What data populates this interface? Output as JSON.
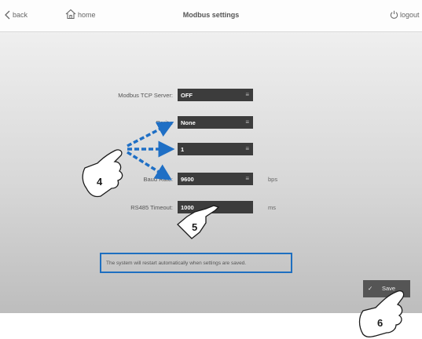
{
  "header": {
    "back_label": "back",
    "home_label": "home",
    "title": "Modbus settings",
    "logout_label": "logout"
  },
  "form": {
    "modbus_tcp_server": {
      "label": "Modbus TCP Server:",
      "value": "OFF"
    },
    "parity": {
      "label": "Parity:",
      "value": "None"
    },
    "stop_bits": {
      "value": "1"
    },
    "baud_rate": {
      "label": "Baud Rate:",
      "value": "9600",
      "unit": "bps"
    },
    "rs485_timeout": {
      "label": "RS485 Timeout:",
      "value": "1000",
      "unit": "ms"
    }
  },
  "notice": "The system will restart automatically when settings are saved.",
  "save_label": "Save",
  "callouts": [
    "4",
    "5",
    "6"
  ],
  "colors": {
    "arrow": "#1f6fc5",
    "notice_border": "#1e6fc0",
    "field_bg": "#3c3c3c"
  },
  "icons": [
    "chevron-left-icon",
    "home-icon",
    "power-icon",
    "menu-lines-icon",
    "check-icon",
    "pointing-hand-icon"
  ]
}
